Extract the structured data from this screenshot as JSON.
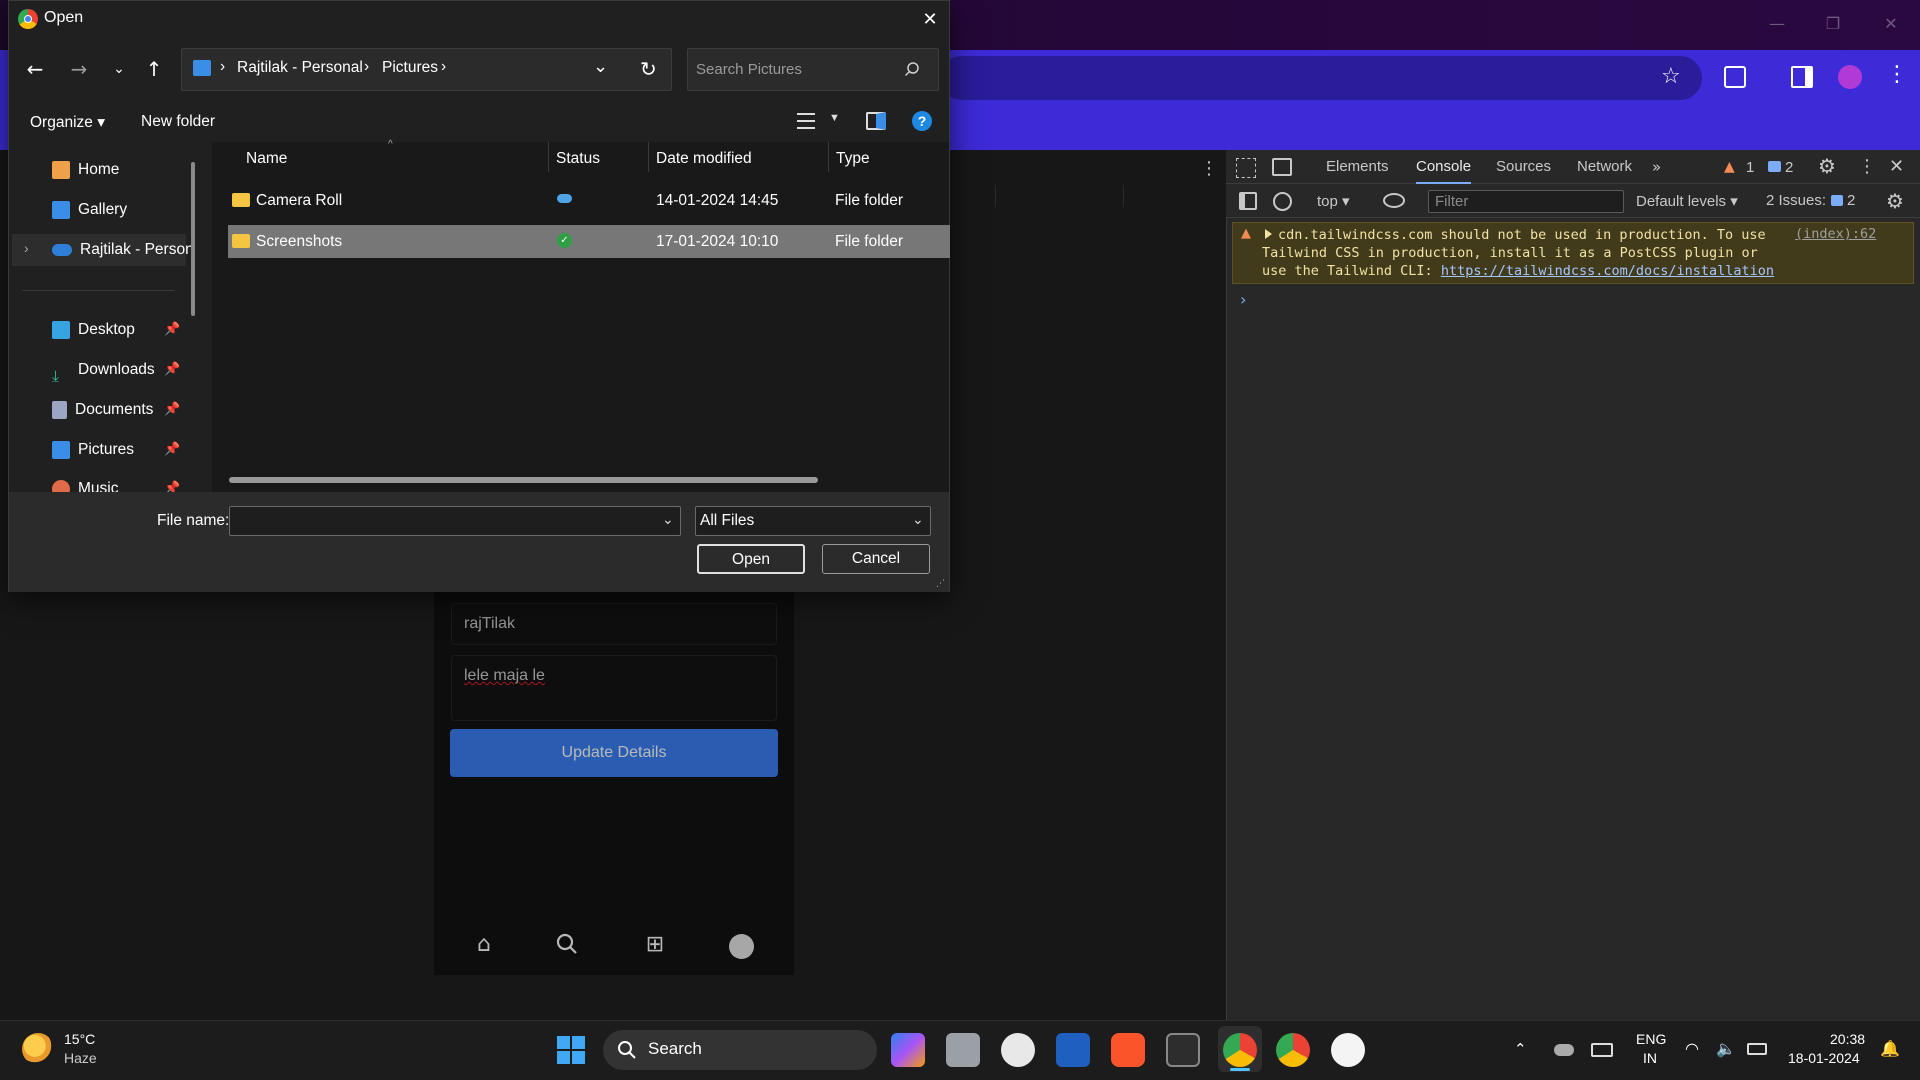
{
  "dialog": {
    "title": "Open",
    "breadcrumb": [
      "Rajtilak - Personal",
      "Pictures"
    ],
    "search_placeholder": "Search Pictures",
    "commands": {
      "organize": "Organize",
      "new_folder": "New folder"
    },
    "nav": [
      {
        "label": "Home",
        "icon": "home-icon",
        "pinned": false
      },
      {
        "label": "Gallery",
        "icon": "gallery-icon",
        "pinned": false
      },
      {
        "label": "Rajtilak - Person",
        "icon": "onedrive-icon",
        "pinned": false
      },
      {
        "label": "Desktop",
        "icon": "desktop-icon",
        "pinned": true
      },
      {
        "label": "Downloads",
        "icon": "download-icon",
        "pinned": true
      },
      {
        "label": "Documents",
        "icon": "documents-icon",
        "pinned": true
      },
      {
        "label": "Pictures",
        "icon": "pictures-icon",
        "pinned": true
      },
      {
        "label": "Music",
        "icon": "music-icon",
        "pinned": true
      }
    ],
    "columns": {
      "name": "Name",
      "status": "Status",
      "date": "Date modified",
      "type": "Type"
    },
    "files": [
      {
        "name": "Camera Roll",
        "status": "cloud-icon",
        "date": "14-01-2024 14:45",
        "type": "File folder",
        "selected": false
      },
      {
        "name": "Screenshots",
        "status": "synced-check-icon",
        "date": "17-01-2024 10:10",
        "type": "File folder",
        "selected": true
      }
    ],
    "file_name_label": "File name:",
    "file_name_value": "",
    "file_type": "All Files",
    "open_label": "Open",
    "cancel_label": "Cancel"
  },
  "page": {
    "username_value": "rajTilak",
    "bio_value": "lele maja le",
    "update_label": "Update Details"
  },
  "devtools": {
    "tabs": [
      "Elements",
      "Console",
      "Sources",
      "Network"
    ],
    "active_tab": "Console",
    "warning_count": "1",
    "message_count": "2",
    "context": "top",
    "filter_placeholder": "Filter",
    "levels": "Default levels",
    "issues_label": "2 Issues:",
    "issues_count": "2",
    "warning_text": "cdn.tailwindcss.com should not be used in production. To use Tailwind CSS in production, install it as a PostCSS plugin or use the Tailwind CLI:",
    "warning_link": "https://tailwindcss.com/docs/installation",
    "warning_source": "(index):62"
  },
  "taskbar": {
    "weather_temp": "15°C",
    "weather_desc": "Haze",
    "search_label": "Search",
    "lang_top": "ENG",
    "lang_bottom": "IN",
    "time": "20:38",
    "date": "18-01-2024"
  },
  "colors": {
    "accent": "#3c2bd6",
    "update_button": "#3b82f6",
    "selection": "#777777",
    "folder": "#f5c542"
  }
}
